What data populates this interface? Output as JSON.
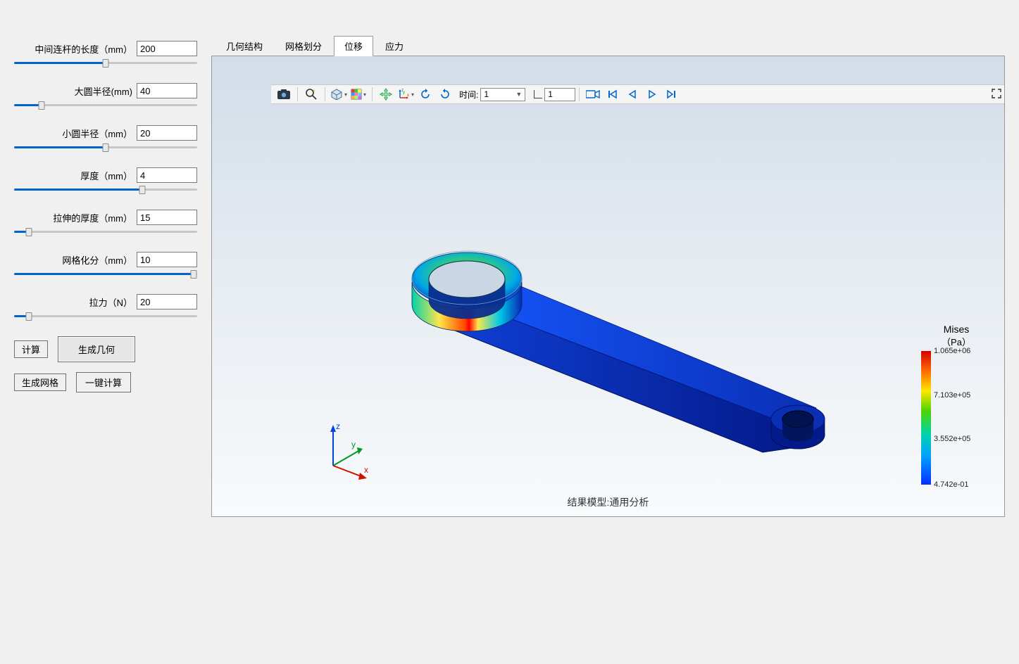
{
  "params": [
    {
      "label": "中间连杆的长度（mm）",
      "value": "200",
      "fill": 50
    },
    {
      "label": "大圆半径(mm)",
      "value": "40",
      "fill": 15
    },
    {
      "label": "小圆半径（mm）",
      "value": "20",
      "fill": 50
    },
    {
      "label": "厚度（mm）",
      "value": "4",
      "fill": 70
    },
    {
      "label": "拉伸的厚度（mm）",
      "value": "15",
      "fill": 8
    },
    {
      "label": "网格化分（mm）",
      "value": "10",
      "fill": 98
    },
    {
      "label": "拉力（N）",
      "value": "20",
      "fill": 8
    }
  ],
  "buttons": {
    "compute": "计算",
    "genGeom": "生成几何",
    "genMesh": "生成网格",
    "oneClick": "一键计算"
  },
  "tabs": [
    "几何结构",
    "网格划分",
    "位移",
    "应力"
  ],
  "activeTab": 2,
  "toolbar": {
    "timeLabel": "时间:",
    "timeValue": "1",
    "frameValue": "1"
  },
  "caption": "结果模型:通用分析",
  "legend": {
    "title": "Mises",
    "unit": "（Pa）",
    "ticks": [
      {
        "pos": 0,
        "text": "1.065e+06"
      },
      {
        "pos": 33,
        "text": "7.103e+05"
      },
      {
        "pos": 66,
        "text": "3.552e+05"
      },
      {
        "pos": 100,
        "text": "4.742e-01"
      }
    ]
  },
  "triad": {
    "x": "x",
    "y": "y",
    "z": "z"
  }
}
